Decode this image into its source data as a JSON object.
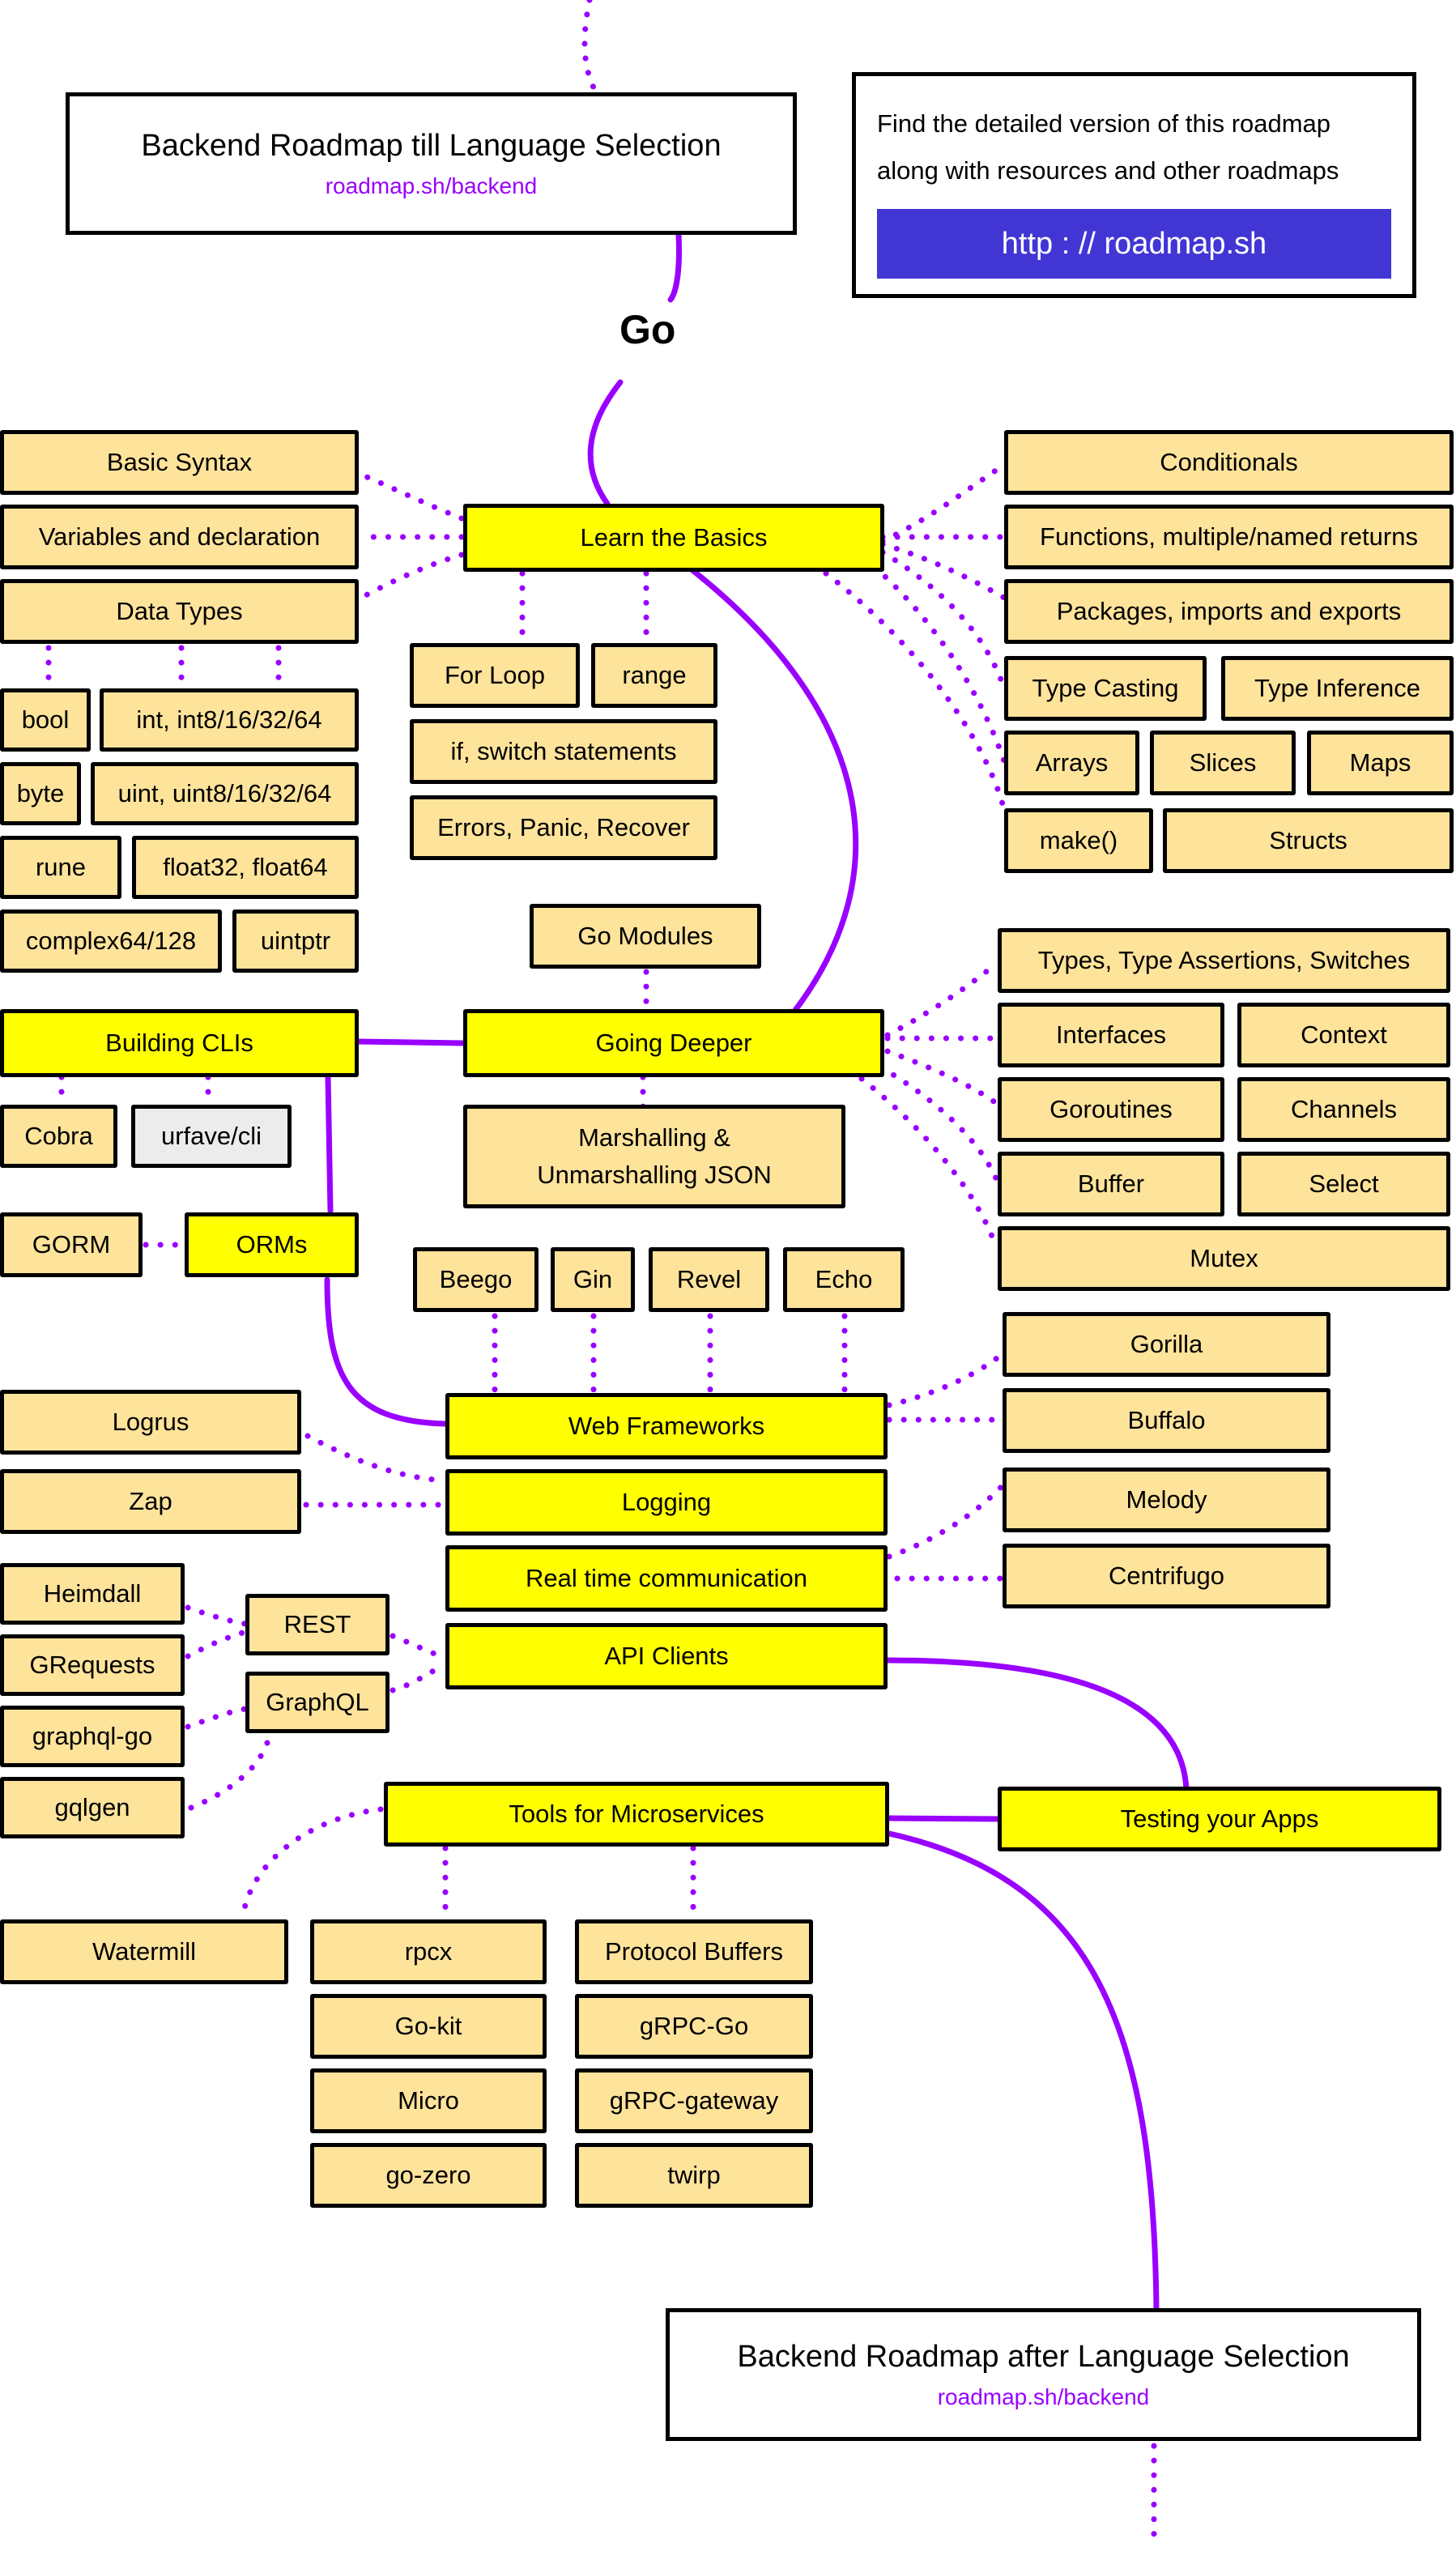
{
  "colors": {
    "topic": "#ffff00",
    "subtopic": "#fee39b",
    "alternative": "#ececec",
    "connector": "#9900ff",
    "cta_button": "#4136d4"
  },
  "header": {
    "title": "Backend Roadmap till Language Selection",
    "link": "roadmap.sh/backend"
  },
  "info": {
    "line1": "Find the detailed version of this roadmap",
    "line2": "along with resources and other roadmaps",
    "button_label": "http : // roadmap.sh"
  },
  "language": "Go",
  "nodes": {
    "learn_basics": "Learn the Basics",
    "basic_syntax": "Basic Syntax",
    "variables": "Variables and declaration",
    "data_types": "Data Types",
    "bool": "bool",
    "int": "int, int8/16/32/64",
    "byte": "byte",
    "uint": "uint, uint8/16/32/64",
    "rune": "rune",
    "float": "float32, float64",
    "complex": "complex64/128",
    "uintptr": "uintptr",
    "for_loop": "For Loop",
    "range": "range",
    "if_switch": "if, switch statements",
    "errors": "Errors, Panic, Recover",
    "conditionals": "Conditionals",
    "functions": "Functions, multiple/named returns",
    "packages": "Packages, imports and exports",
    "type_casting": "Type Casting",
    "type_inference": "Type Inference",
    "arrays": "Arrays",
    "slices": "Slices",
    "maps": "Maps",
    "make": "make()",
    "structs": "Structs",
    "go_modules": "Go Modules",
    "going_deeper": "Going Deeper",
    "marshalling": "Marshalling & Unmarshalling JSON",
    "types_assertions": "Types, Type Assertions, Switches",
    "interfaces": "Interfaces",
    "context": "Context",
    "goroutines": "Goroutines",
    "channels": "Channels",
    "buffer": "Buffer",
    "select": "Select",
    "mutex": "Mutex",
    "building_clis": "Building CLIs",
    "cobra": "Cobra",
    "urfave": "urfave/cli",
    "orms": "ORMs",
    "gorm": "GORM",
    "beego": "Beego",
    "gin": "Gin",
    "revel": "Revel",
    "echo": "Echo",
    "web_frameworks": "Web Frameworks",
    "gorilla": "Gorilla",
    "buffalo": "Buffalo",
    "logging": "Logging",
    "logrus": "Logrus",
    "zap": "Zap",
    "realtime": "Real time communication",
    "melody": "Melody",
    "centrifugo": "Centrifugo",
    "api_clients": "API Clients",
    "rest": "REST",
    "graphql": "GraphQL",
    "heimdall": "Heimdall",
    "grequests": "GRequests",
    "graphql_go": "graphql-go",
    "gqlgen": "gqlgen",
    "microservices": "Tools for Microservices",
    "testing": "Testing your Apps",
    "watermill": "Watermill",
    "rpcx": "rpcx",
    "go_kit": "Go-kit",
    "micro": "Micro",
    "go_zero": "go-zero",
    "protobuf": "Protocol Buffers",
    "grpc_go": "gRPC-Go",
    "grpc_gateway": "gRPC-gateway",
    "twirp": "twirp"
  },
  "footer": {
    "title": "Backend Roadmap after Language Selection",
    "link": "roadmap.sh/backend"
  }
}
